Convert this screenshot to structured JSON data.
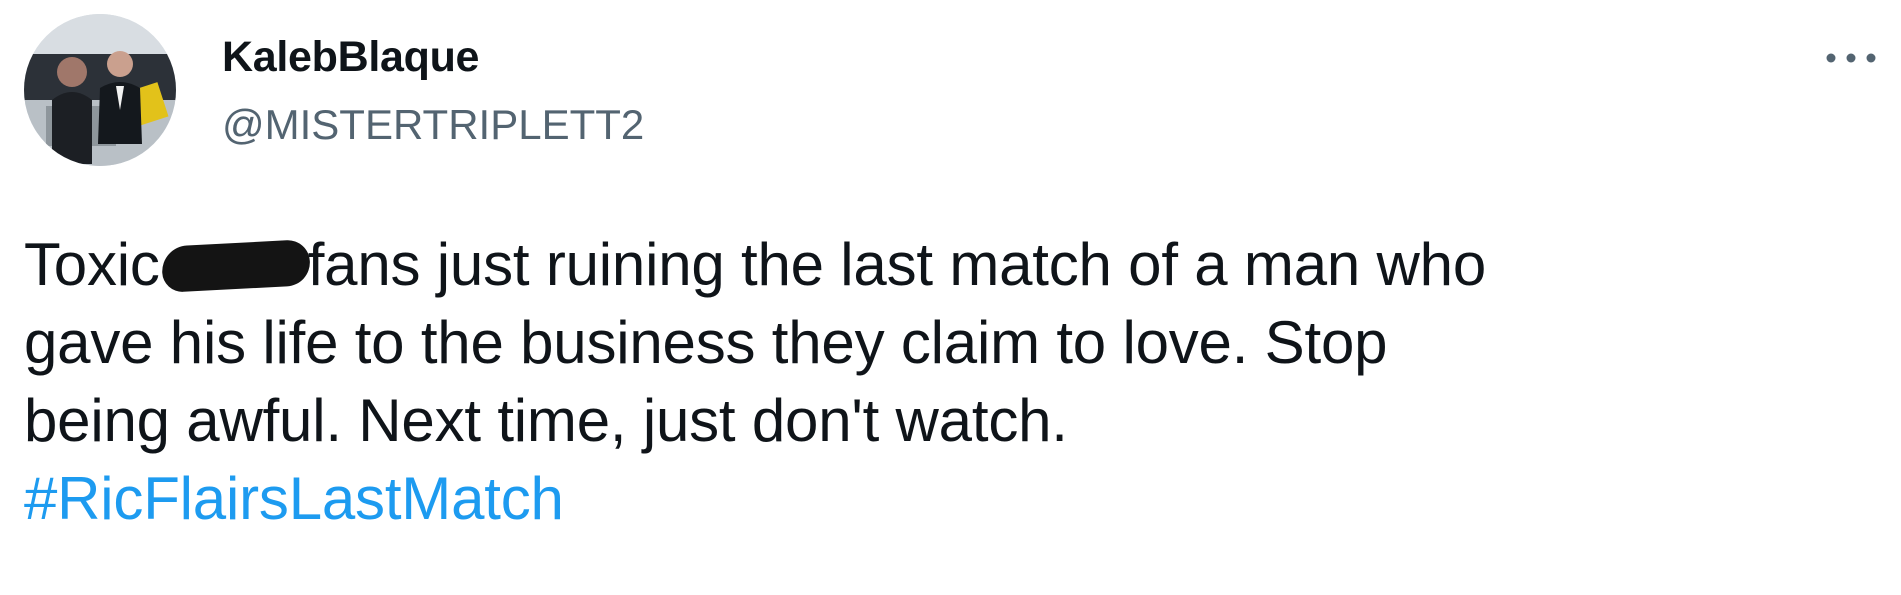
{
  "tweet": {
    "display_name": "KalebBlaque",
    "handle": "@MISTERTRIPLETT2",
    "more_icon": "ellipsis-icon",
    "avatar_icon": "profile-photo",
    "text": {
      "line1_start": "Toxic",
      "line1_end": "fans just ruining the last match of a man who",
      "line2": "gave his life to the business they claim to love. Stop",
      "line3": "being awful. Next time, just don't watch.",
      "hashtag": "#RicFlairsLastMatch"
    },
    "colors": {
      "text": "#0f1419",
      "secondary": "#536471",
      "link": "#1d9bf0",
      "redaction": "#141414"
    }
  }
}
